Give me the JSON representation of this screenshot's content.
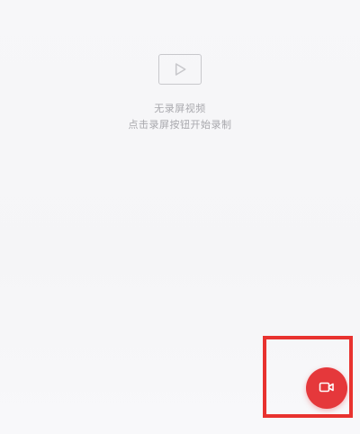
{
  "empty_state": {
    "icon": "video-play-icon",
    "title": "无录屏视频",
    "hint": "点击录屏按钮开始录制"
  },
  "record_button": {
    "icon": "video-camera-icon",
    "color": "#e5383b"
  },
  "highlight": {
    "color": "#e8322f"
  }
}
